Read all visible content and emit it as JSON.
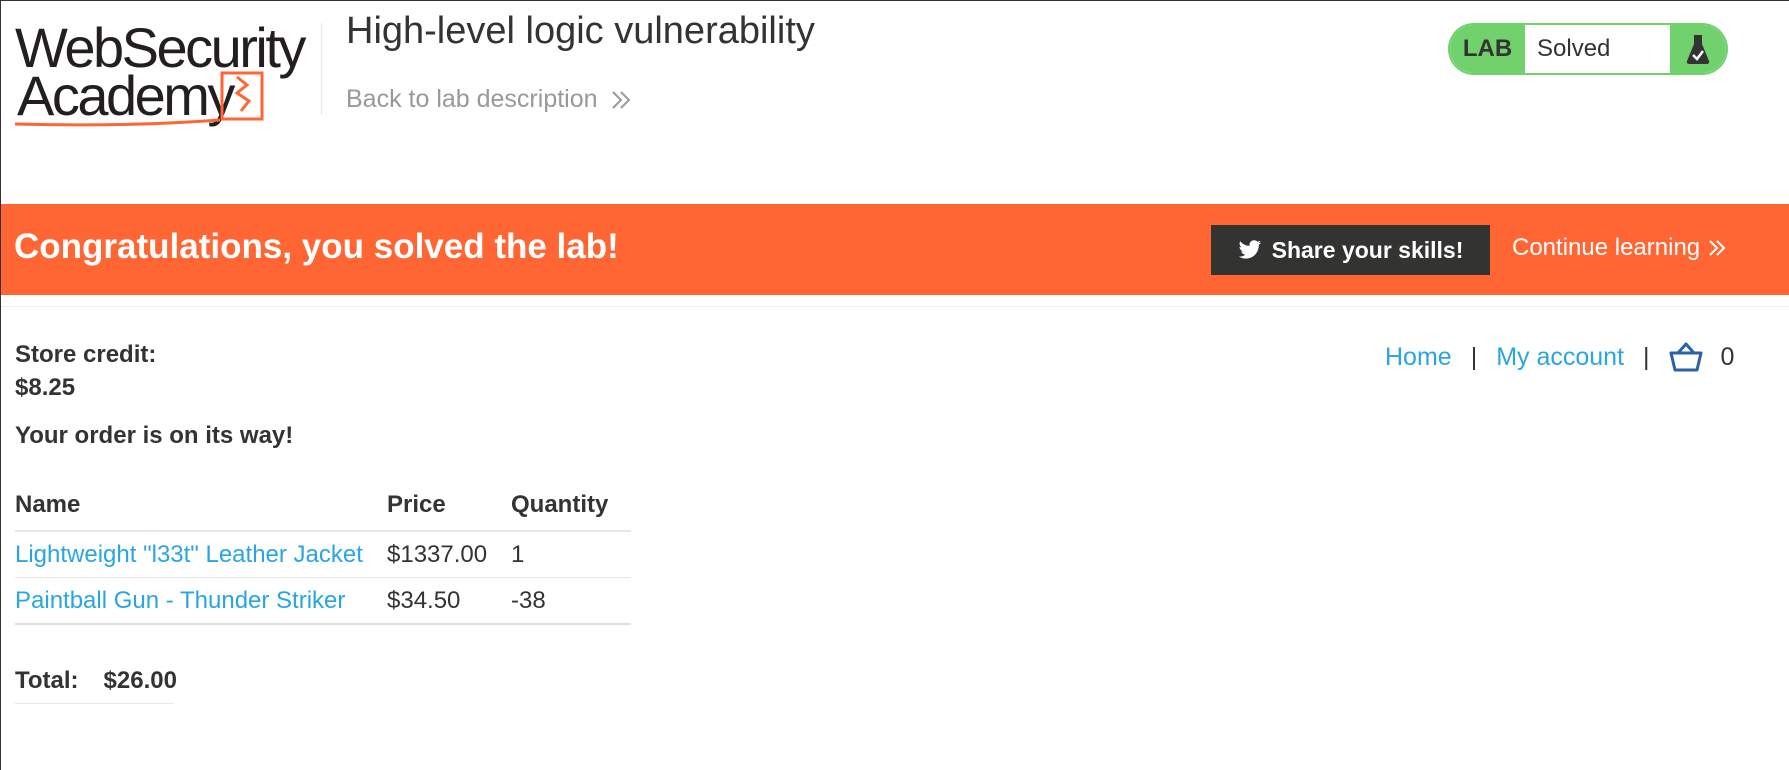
{
  "header": {
    "logo": {
      "line1": "WebSecurity",
      "line2": "Academy"
    },
    "title": "High-level logic vulnerability",
    "back_link": "Back to lab description",
    "lab_status": {
      "label": "LAB",
      "state": "Solved",
      "icon": "flask-check-icon"
    }
  },
  "banner": {
    "message": "Congratulations, you solved the lab!",
    "share_label": "Share your skills!",
    "continue_label": "Continue learning",
    "color": "#ff6633"
  },
  "store": {
    "credit_label": "Store credit:",
    "credit_value": "$8.25",
    "order_message": "Your order is on its way!"
  },
  "nav": {
    "home": "Home",
    "my_account": "My account",
    "separator": "|",
    "cart_count": "0"
  },
  "order_table": {
    "headers": [
      "Name",
      "Price",
      "Quantity"
    ],
    "rows": [
      {
        "name": "Lightweight \"l33t\" Leather Jacket",
        "price": "$1337.00",
        "quantity": "1"
      },
      {
        "name": "Paintball Gun - Thunder Striker",
        "price": "$34.50",
        "quantity": "-38"
      }
    ]
  },
  "total": {
    "label": "Total:",
    "value": "$26.00"
  },
  "colors": {
    "accent_link": "#29a6df",
    "solved_green": "#70d16d",
    "banner_orange": "#ff6633",
    "dark_button": "#333332"
  }
}
